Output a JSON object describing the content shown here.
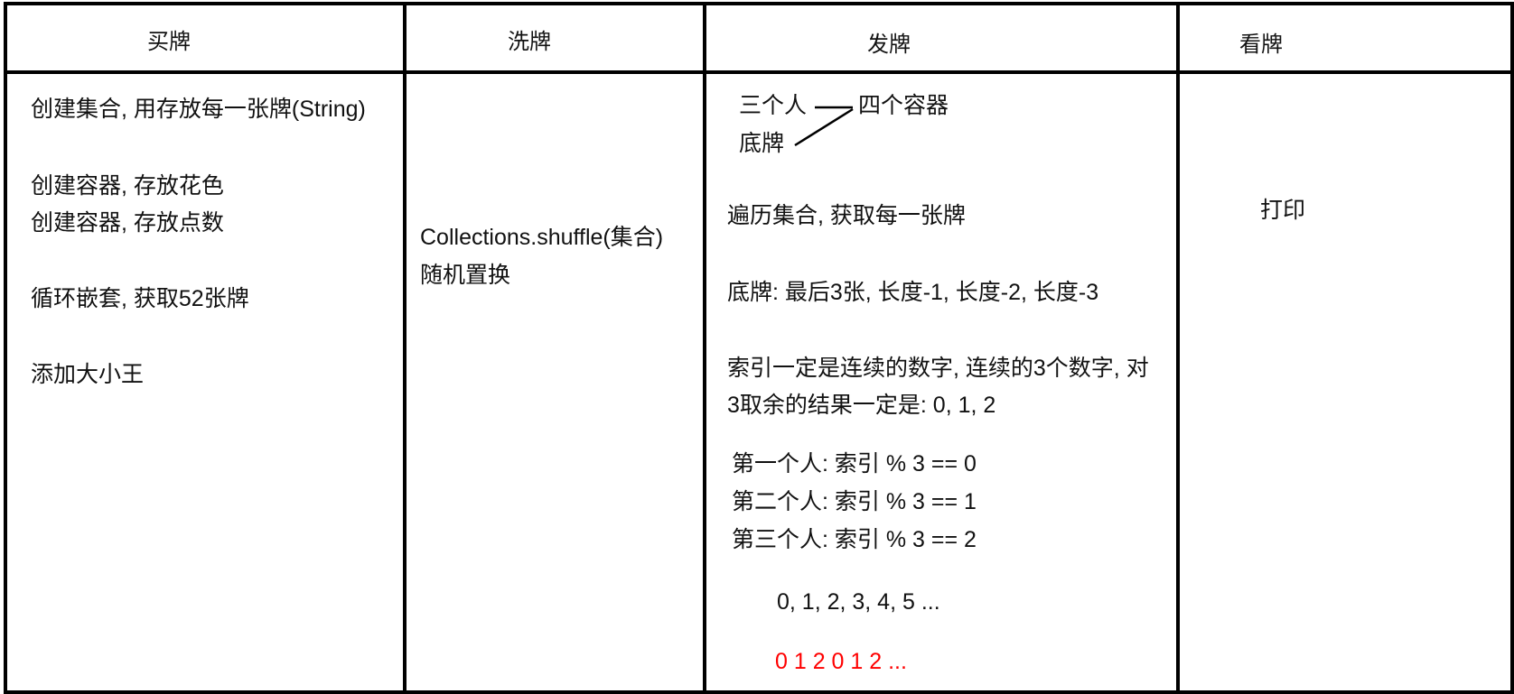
{
  "headers": [
    "买牌",
    "洗牌",
    "发牌",
    "看牌"
  ],
  "col_buy": {
    "line1": "创建集合, 用存放每一张牌(String)",
    "line2": "创建容器, 存放花色",
    "line3": "创建容器, 存放点数",
    "line4": "循环嵌套, 获取52张牌",
    "line5": "添加大小王"
  },
  "col_shuffle": {
    "line1": "Collections.shuffle(集合)",
    "line2": "随机置换"
  },
  "col_deal": {
    "three_people": "三个人",
    "four_containers": "四个容器",
    "bottom_cards": "底牌",
    "traverse": "遍历集合, 获取每一张牌",
    "bottom_rule": "底牌:  最后3张, 长度-1, 长度-2, 长度-3",
    "index_line1": "索引一定是连续的数字, 连续的3个数字, 对",
    "index_line2": "3取余的结果一定是: 0, 1, 2",
    "person1": "第一个人: 索引 % 3 == 0",
    "person2": "第二个人: 索引 % 3 == 1",
    "person3": "第三个人: 索引 % 3 == 2",
    "sequence": "0, 1, 2, 3, 4, 5 ...",
    "remainders": "0  1   2  0  1  2 ..."
  },
  "col_view": {
    "line1": "打印"
  },
  "colors": {
    "lines": "#000000",
    "text": "#111111",
    "highlight": "#ff0000"
  }
}
